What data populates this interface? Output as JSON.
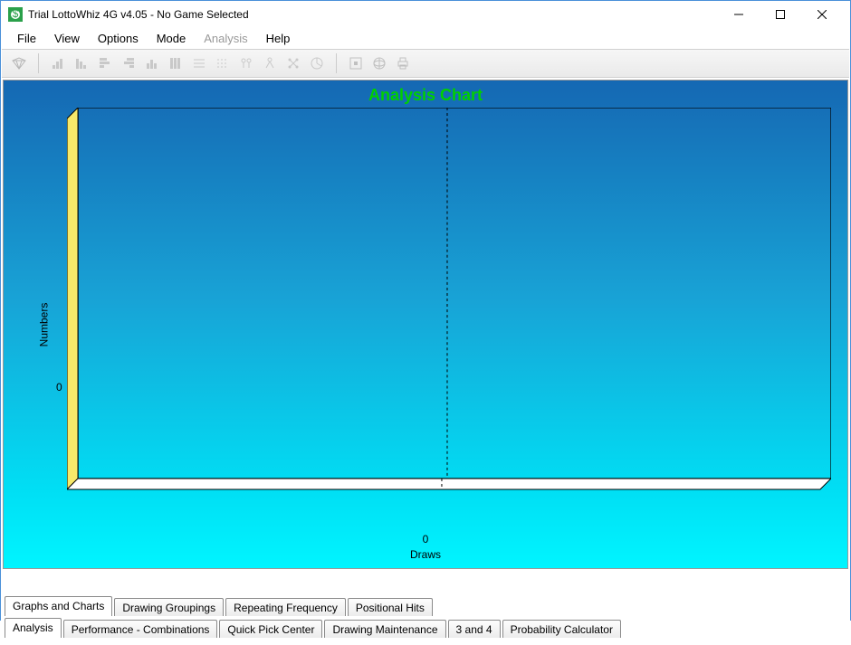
{
  "window": {
    "title": "Trial LottoWhiz 4G v4.05 - No Game Selected"
  },
  "menu": {
    "file": "File",
    "view": "View",
    "options": "Options",
    "mode": "Mode",
    "analysis": "Analysis",
    "help": "Help"
  },
  "chart": {
    "title": "Analysis Chart",
    "ylabel": "Numbers",
    "xlabel": "Draws",
    "ytick": "0",
    "xtick": "0"
  },
  "inner_tabs": [
    "Graphs and Charts",
    "Drawing Groupings",
    "Repeating Frequency",
    "Positional Hits"
  ],
  "outer_tabs": [
    "Analysis",
    "Performance - Combinations",
    "Quick Pick Center",
    "Drawing Maintenance",
    "3 and 4",
    "Probability Calculator"
  ],
  "chart_data": {
    "type": "bar",
    "categories": [],
    "values": [],
    "title": "Analysis Chart",
    "xlabel": "Draws",
    "ylabel": "Numbers",
    "xlim": [
      0,
      0
    ],
    "ylim": [
      0,
      0
    ]
  }
}
